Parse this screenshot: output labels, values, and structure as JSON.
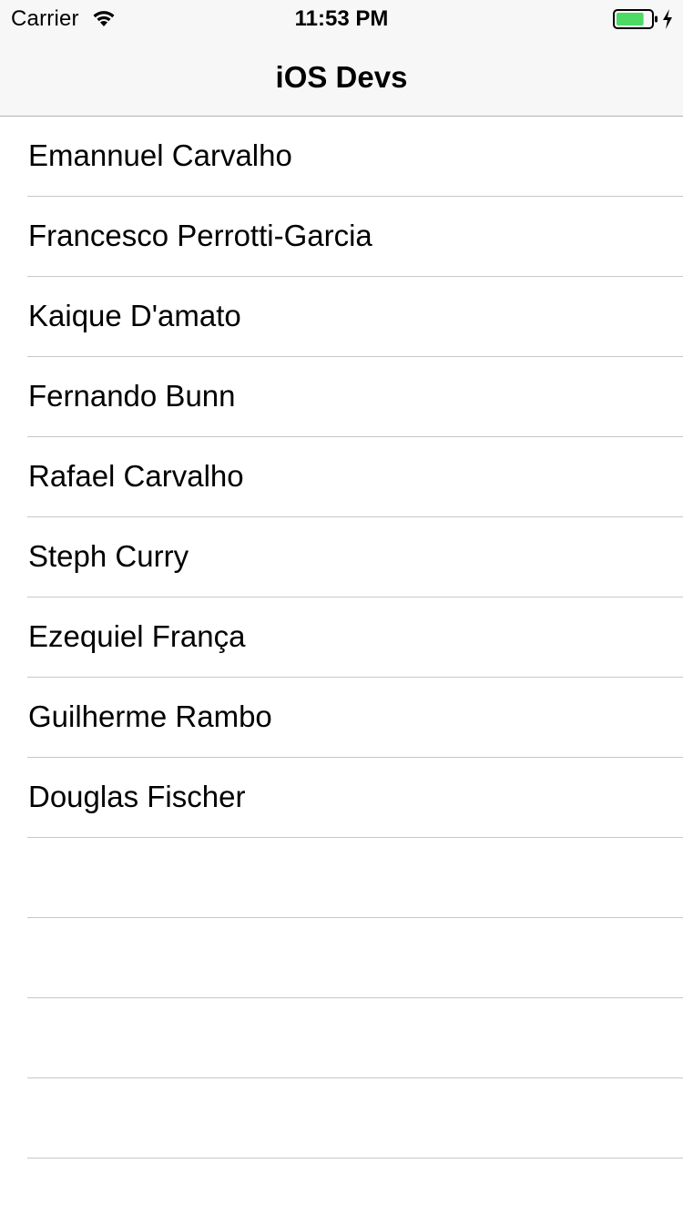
{
  "status_bar": {
    "carrier": "Carrier",
    "time": "11:53 PM",
    "wifi_icon": "wifi-icon",
    "battery_icon": "battery-icon",
    "charging_icon": "charging-bolt-icon",
    "battery_color": "#4cd964",
    "battery_level": 0.8
  },
  "nav_bar": {
    "title": "iOS Devs",
    "background": "#f7f7f7"
  },
  "table": {
    "rows": [
      {
        "label": "Emannuel Carvalho"
      },
      {
        "label": "Francesco Perrotti-Garcia"
      },
      {
        "label": "Kaique D'amato"
      },
      {
        "label": "Fernando Bunn"
      },
      {
        "label": "Rafael Carvalho"
      },
      {
        "label": "Steph Curry"
      },
      {
        "label": "Ezequiel França"
      },
      {
        "label": "Guilherme Rambo"
      },
      {
        "label": "Douglas Fischer"
      },
      {
        "label": ""
      },
      {
        "label": ""
      },
      {
        "label": ""
      },
      {
        "label": ""
      },
      {
        "label": ""
      }
    ],
    "separator_color": "#c8c7cc"
  }
}
